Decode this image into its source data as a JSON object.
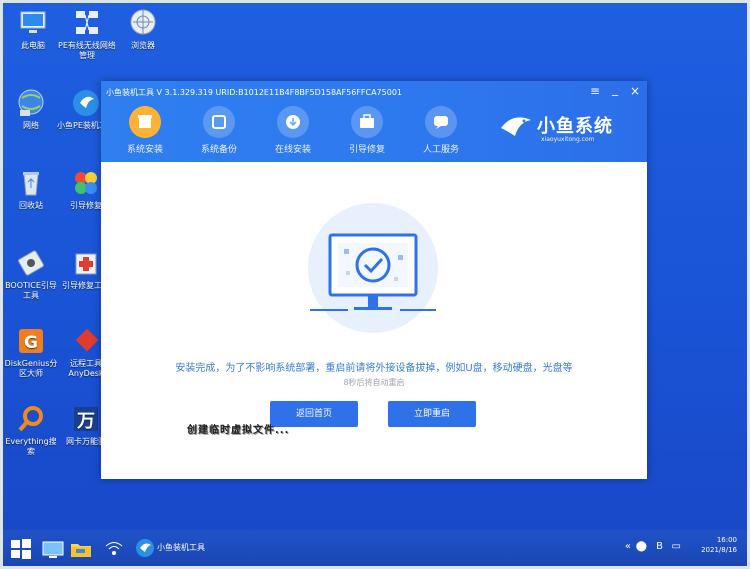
{
  "desktop": {
    "icons": [
      {
        "name": "此电脑",
        "icon": "computer-icon"
      },
      {
        "name": "PE有线无线网络管理",
        "icon": "network-manager-icon"
      },
      {
        "name": "浏览器",
        "icon": "browser-icon"
      },
      {
        "name": "网络",
        "icon": "network-icon"
      },
      {
        "name": "小鱼PE装机工具",
        "icon": "xiaoyu-pe-icon"
      },
      {
        "name": "回收站",
        "icon": "recycle-bin-icon"
      },
      {
        "name": "引导修复",
        "icon": "boot-repair-icon"
      },
      {
        "name": "BOOTICE引导工具",
        "icon": "bootice-icon"
      },
      {
        "name": "引导修复工具",
        "icon": "boot-repair-tool-icon"
      },
      {
        "name": "DiskGenius分区大师",
        "icon": "diskgenius-icon"
      },
      {
        "name": "远程工具AnyDesk",
        "icon": "anydesk-icon"
      },
      {
        "name": "Everything搜索",
        "icon": "everything-icon"
      },
      {
        "name": "网卡万能驱",
        "icon": "nic-driver-icon"
      }
    ]
  },
  "window": {
    "title": "小鱼装机工具 V 3.1.329.319 URID:B1012E11B4F8BF5D158AF56FFCA75001",
    "controls": {
      "menu": "≡",
      "minimize": "_",
      "close": "×"
    },
    "tabs": [
      {
        "label": "系统安装",
        "active": true,
        "icon": "system-install-icon"
      },
      {
        "label": "系统备份",
        "active": false,
        "icon": "system-backup-icon"
      },
      {
        "label": "在线安装",
        "active": false,
        "icon": "online-install-icon"
      },
      {
        "label": "引导修复",
        "active": false,
        "icon": "boot-repair-icon"
      },
      {
        "label": "人工服务",
        "active": false,
        "icon": "support-chat-icon"
      }
    ],
    "brand": {
      "name": "小鱼系统",
      "url": "xiaoyuxitong.com"
    },
    "message": "安装完成，为了不影响系统部署，重启前请将外接设备拔掉，例如U盘，移动硬盘，光盘等",
    "countdown": "8秒后将自动重启",
    "buttons": {
      "back": "返回首页",
      "restart": "立即重启"
    },
    "overlay_text": "创建临时虚拟文件..."
  },
  "taskbar": {
    "app_label": "小鱼装机工具",
    "time": "16:00",
    "date": "2021/8/16"
  },
  "colors": {
    "desktop_blue": "#1e5fe0",
    "header_blue": "#2f7ff0",
    "button_blue": "#2f71e8",
    "active_tab_orange": "#ffb235",
    "message_blue": "#3b7bd8"
  }
}
